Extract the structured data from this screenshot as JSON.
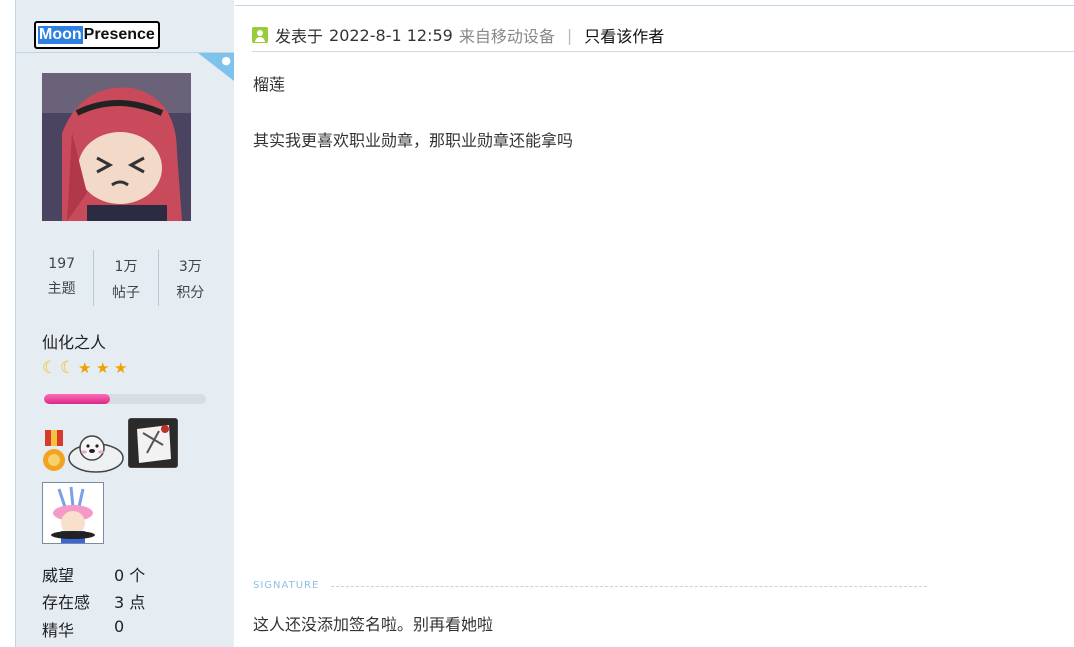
{
  "user": {
    "name_part1": "Moon",
    "name_part2": "Presence",
    "stats": [
      {
        "value": "197",
        "label": "主题"
      },
      {
        "value": "1万",
        "label": "帖子"
      },
      {
        "value": "3万",
        "label": "积分"
      }
    ],
    "rank_title": "仙化之人",
    "rank_icons": [
      "moon-icon",
      "moon-icon",
      "star-icon",
      "star-icon",
      "star-icon"
    ],
    "level_progress": 0.41,
    "medals": [
      "ribbon-medal-icon",
      "seal-medal-icon",
      "scroll-medal-icon",
      "mage-medal-icon"
    ],
    "info": [
      {
        "key": "威望",
        "value": "0 个"
      },
      {
        "key": "存在感",
        "value": "3 点"
      },
      {
        "key": "精华",
        "value": "0"
      }
    ]
  },
  "post": {
    "posted_prefix": "发表于",
    "datetime": "2022-8-1 12:59",
    "source": "来自移动设备",
    "separator": "|",
    "only_author": "只看该作者",
    "lines": [
      "榴莲",
      "其实我更喜欢职业勋章，那职业勋章还能拿吗"
    ],
    "signature_label": "SIGNATURE",
    "signature_text": "这人还没添加签名啦。别再看她啦"
  },
  "colors": {
    "sidebar_bg": "#e5edf2",
    "progress_fill": "#e63c9b",
    "online_icon": "#9acb3a",
    "signature_label": "#8ec0e0"
  }
}
